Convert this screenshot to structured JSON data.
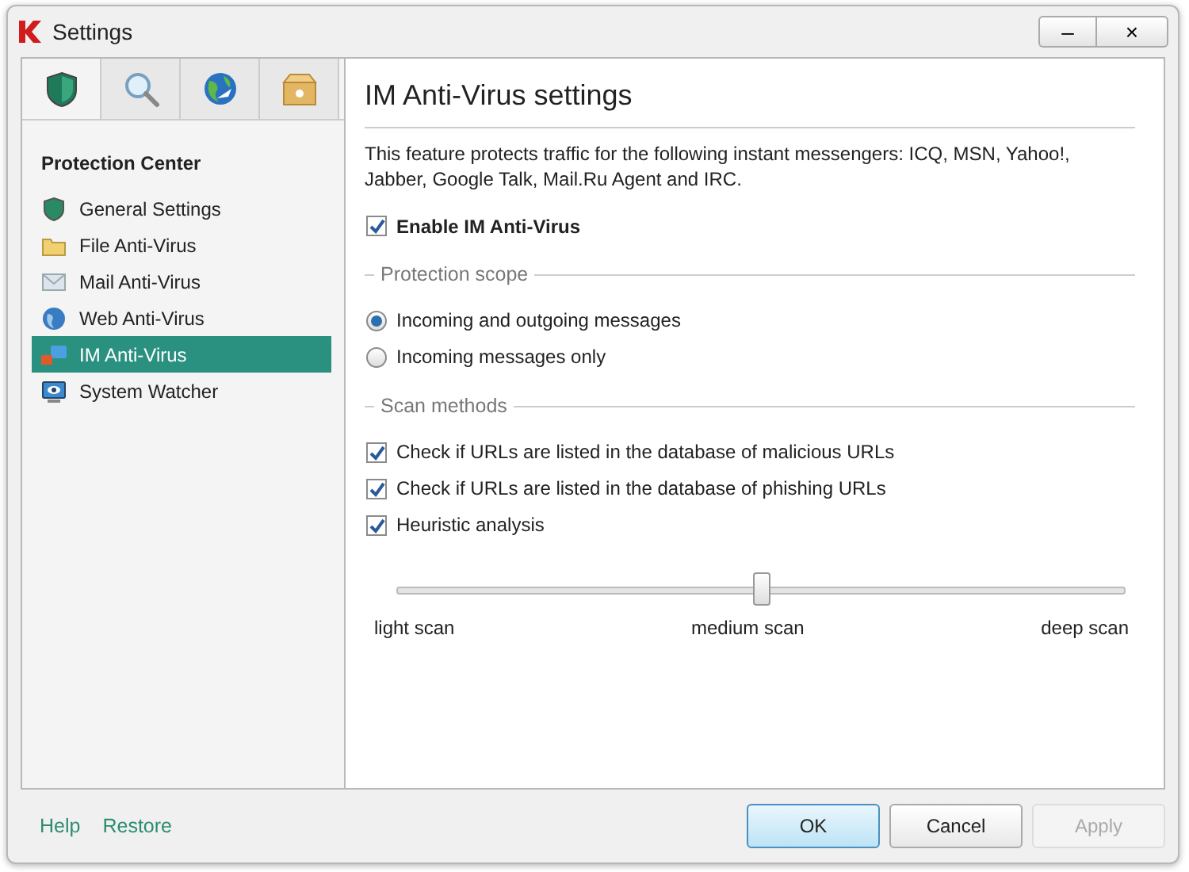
{
  "window": {
    "title": "Settings",
    "minimize": "–",
    "close": "×"
  },
  "sidebar": {
    "tabs": [
      {
        "selected": true
      },
      {
        "selected": false
      },
      {
        "selected": false
      },
      {
        "selected": false
      }
    ],
    "heading": "Protection Center",
    "items": [
      {
        "label": "General Settings",
        "selected": false
      },
      {
        "label": "File Anti-Virus",
        "selected": false
      },
      {
        "label": "Mail Anti-Virus",
        "selected": false
      },
      {
        "label": "Web Anti-Virus",
        "selected": false
      },
      {
        "label": "IM Anti-Virus",
        "selected": true
      },
      {
        "label": "System Watcher",
        "selected": false
      }
    ]
  },
  "content": {
    "title": "IM Anti-Virus settings",
    "description": "This feature protects traffic for the following instant messengers: ICQ, MSN, Yahoo!, Jabber, Google Talk, Mail.Ru Agent and IRC.",
    "enable": {
      "label": "Enable IM Anti-Virus",
      "checked": true
    },
    "protection_scope": {
      "legend": "Protection scope",
      "options": [
        {
          "label": "Incoming and outgoing messages",
          "selected": true
        },
        {
          "label": "Incoming messages only",
          "selected": false
        }
      ]
    },
    "scan_methods": {
      "legend": "Scan methods",
      "options": [
        {
          "label": "Check if URLs are listed in the database of malicious URLs",
          "checked": true
        },
        {
          "label": "Check if URLs are listed in the database of phishing URLs",
          "checked": true
        },
        {
          "label": "Heuristic analysis",
          "checked": true
        }
      ],
      "slider": {
        "level": 0.5,
        "labels": [
          "light scan",
          "medium scan",
          "deep scan"
        ]
      }
    }
  },
  "footer": {
    "links": [
      "Help",
      "Restore"
    ],
    "buttons": [
      {
        "label": "OK",
        "default": true,
        "disabled": false
      },
      {
        "label": "Cancel",
        "default": false,
        "disabled": false
      },
      {
        "label": "Apply",
        "default": false,
        "disabled": true
      }
    ]
  }
}
